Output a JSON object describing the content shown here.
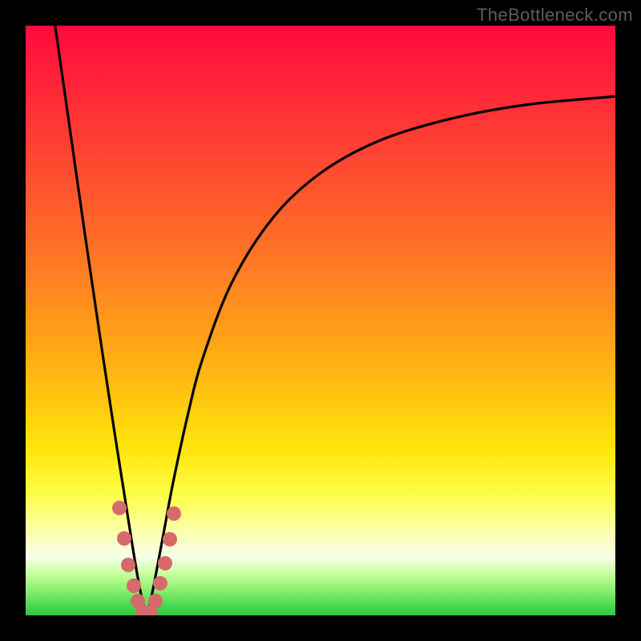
{
  "watermark": "TheBottleneck.com",
  "colors": {
    "frame": "#000000",
    "curve": "#000000",
    "dot": "#d66a6a",
    "gradient_top": "#ff0a3b",
    "gradient_bottom": "#30c746"
  },
  "chart_data": {
    "type": "line",
    "title": "",
    "xlabel": "",
    "ylabel": "",
    "xlim": [
      0,
      100
    ],
    "ylim": [
      0,
      100
    ],
    "notes": "Heat-map style bottleneck chart. Y is mismatch % (0 bottom = balanced green, 100 top = severe bottleneck red). Single V-shaped curve reaching minimum near x≈20.5.",
    "series": [
      {
        "name": "bottleneck-curve",
        "x": [
          5.0,
          7.5,
          10.0,
          12.5,
          15.0,
          16.5,
          18.0,
          19.0,
          20.0,
          20.5,
          21.0,
          22.0,
          23.5,
          25.0,
          27.5,
          30.0,
          35.0,
          42.0,
          50.0,
          60.0,
          72.0,
          85.0,
          100.0
        ],
        "y": [
          100.0,
          82.5,
          65.0,
          48.0,
          31.5,
          22.0,
          12.5,
          6.5,
          1.5,
          0.0,
          1.5,
          6.5,
          14.5,
          22.5,
          34.0,
          43.5,
          56.5,
          67.5,
          75.0,
          80.5,
          84.2,
          86.6,
          88.0
        ]
      }
    ],
    "highlight_points": {
      "name": "cluster-dots",
      "points": [
        {
          "x": 15.9,
          "y": 18.2
        },
        {
          "x": 16.7,
          "y": 13.0
        },
        {
          "x": 17.4,
          "y": 8.6
        },
        {
          "x": 18.3,
          "y": 5.0
        },
        {
          "x": 19.0,
          "y": 2.4
        },
        {
          "x": 19.8,
          "y": 0.5
        },
        {
          "x": 20.5,
          "y": 0.0
        },
        {
          "x": 21.2,
          "y": 0.5
        },
        {
          "x": 22.0,
          "y": 2.5
        },
        {
          "x": 22.8,
          "y": 5.4
        },
        {
          "x": 23.6,
          "y": 8.8
        },
        {
          "x": 24.4,
          "y": 12.9
        },
        {
          "x": 25.2,
          "y": 17.3
        }
      ]
    }
  }
}
